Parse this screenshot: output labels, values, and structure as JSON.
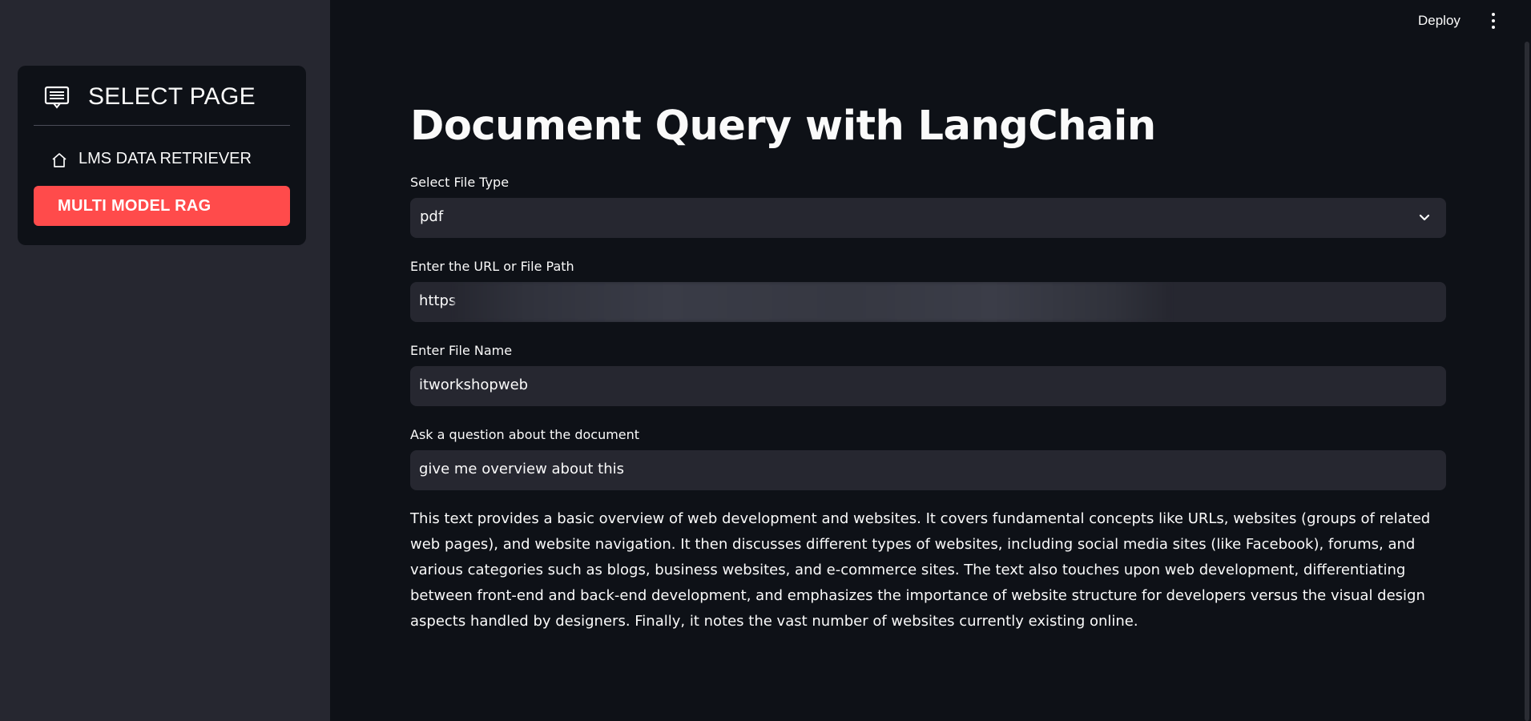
{
  "sidebar": {
    "menu_title": "SELECT PAGE",
    "menu_icon": "list-alt-icon",
    "items": [
      {
        "label": "LMS DATA RETRIEVER",
        "icon": "house-icon",
        "active": false
      },
      {
        "label": "MULTI MODEL RAG",
        "icon": "",
        "active": true
      }
    ]
  },
  "topbar": {
    "deploy_label": "Deploy",
    "menu_icon": "vertical-ellipsis-icon"
  },
  "main": {
    "title": "Document Query with LangChain",
    "file_type": {
      "label": "Select File Type",
      "value": "pdf"
    },
    "url": {
      "label": "Enter the URL or File Path",
      "value": "https"
    },
    "file_name": {
      "label": "Enter File Name",
      "value": "itworkshopweb"
    },
    "question": {
      "label": "Ask a question about the document",
      "value": "give me overview about this"
    },
    "answer": "This text provides a basic overview of web development and websites. It covers fundamental concepts like URLs, websites (groups of related web pages), and website navigation. It then discusses different types of websites, including social media sites (like Facebook), forums, and various categories such as blogs, business websites, and e-commerce sites. The text also touches upon web development, differentiating between front-end and back-end development, and emphasizes the importance of website structure for developers versus the visual design aspects handled by designers. Finally, it notes the vast number of websites currently existing online."
  },
  "colors": {
    "background": "#0e1117",
    "sidebar": "#262730",
    "accent": "#ff4b4b",
    "input": "#262730",
    "text": "#fafafa"
  }
}
